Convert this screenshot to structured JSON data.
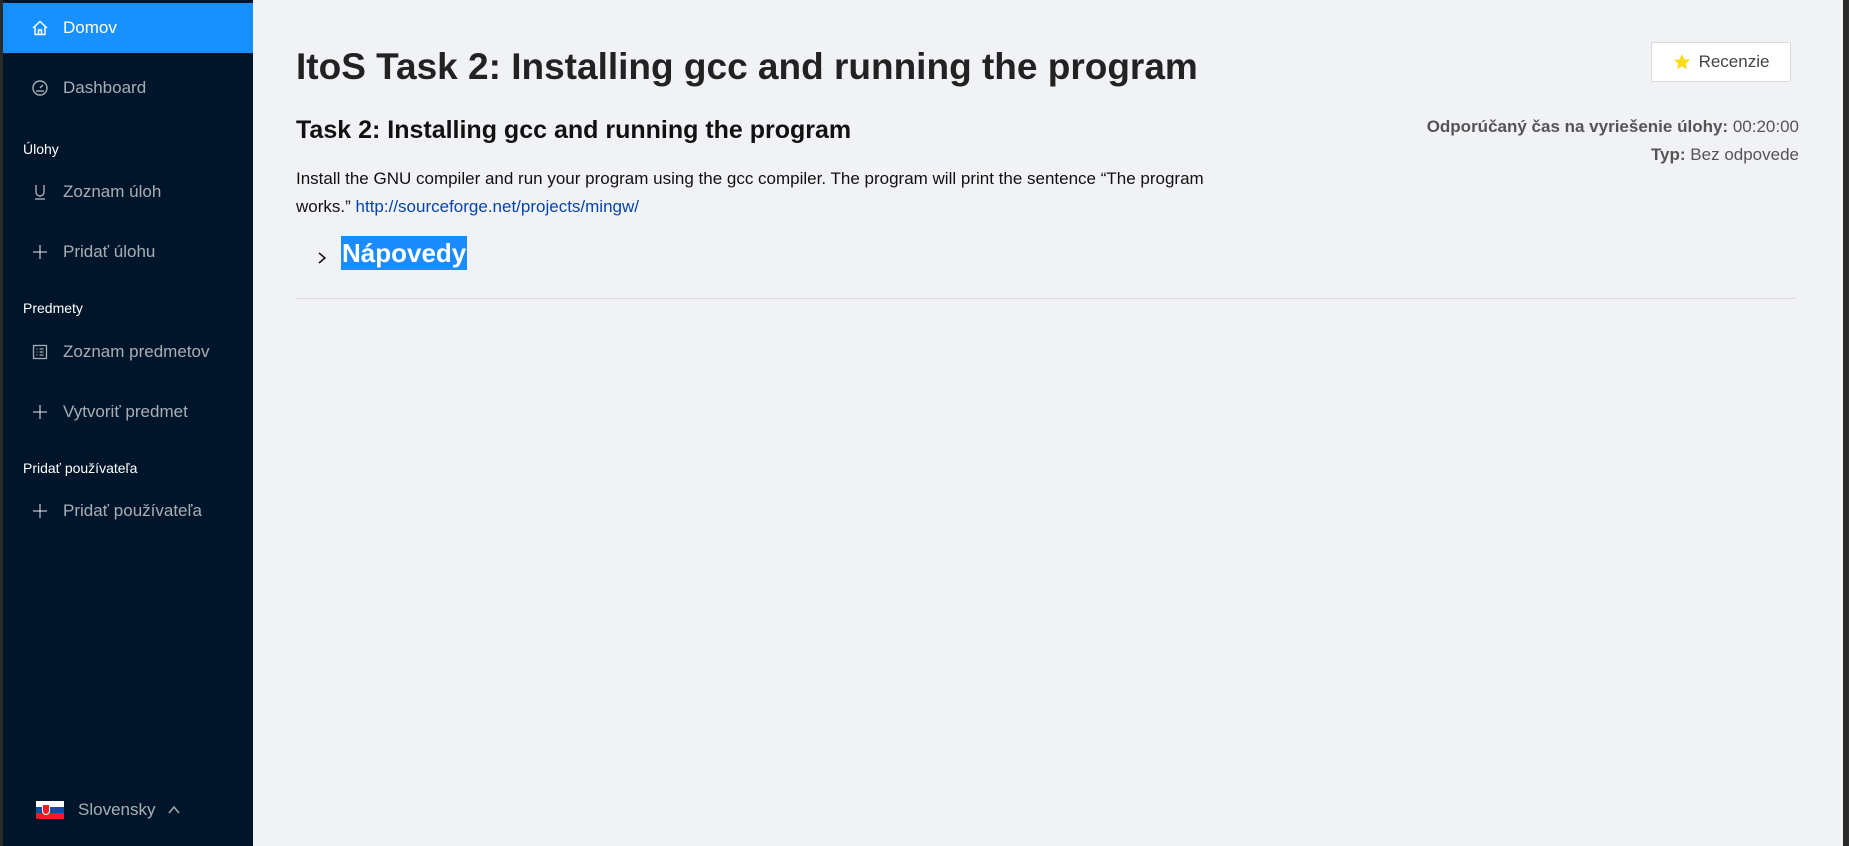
{
  "sidebar": {
    "items": [
      {
        "label": "Domov",
        "icon": "home-icon"
      },
      {
        "label": "Dashboard",
        "icon": "dashboard-icon"
      },
      {
        "label": "Zoznam úloh",
        "icon": "underline-icon"
      },
      {
        "label": "Pridať úlohu",
        "icon": "plus-icon"
      },
      {
        "label": "Zoznam predmetov",
        "icon": "list-icon"
      },
      {
        "label": "Vytvoriť predmet",
        "icon": "plus-icon"
      },
      {
        "label": "Pridať používateľa",
        "icon": "plus-icon"
      }
    ],
    "groups": [
      "Úlohy",
      "Predmety",
      "Pridať používateľa"
    ],
    "language": "Slovensky",
    "active_color": "#1890ff",
    "background": "#001529"
  },
  "main": {
    "title": "ItoS Task 2: Installing gcc and running the program",
    "review_button": "Recenzie",
    "task_title": "Task 2: Installing gcc and running the program",
    "meta": {
      "time_label": "Odporúčaný čas na vyriešenie úlohy:",
      "time_value": "00:20:00",
      "type_label": "Typ:",
      "type_value": "Bez odpovede"
    },
    "description": "Install the GNU compiler and run your program using the gcc compiler. The program will print the sentence “The program works.”",
    "link": "http://sourceforge.net/projects/mingw/",
    "hints_label": "Nápovedy"
  }
}
